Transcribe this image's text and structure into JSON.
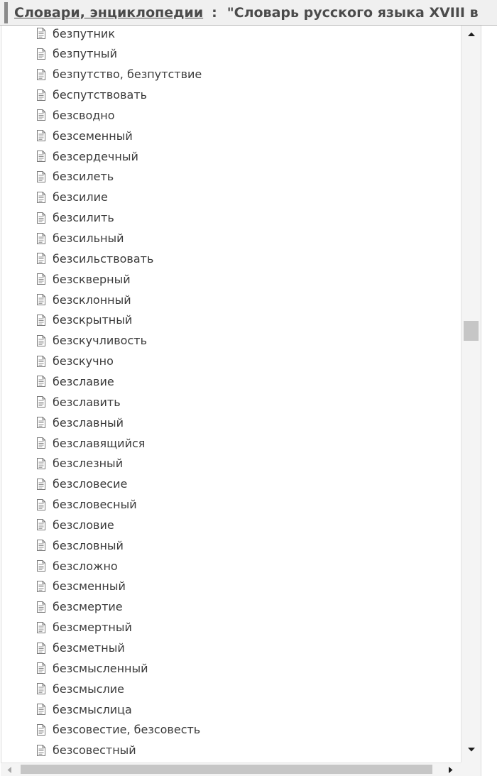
{
  "breadcrumb": {
    "category": "Словари, энциклопедии",
    "separator": ":",
    "document": "\"Словарь русского языка XVIII в"
  },
  "tree": {
    "items": [
      "безпутник",
      "безпутный",
      "безпутство, безпутствие",
      "беспутствовать",
      "безсводно",
      "безсеменный",
      "безсердечный",
      "безсилеть",
      "безсилие",
      "безсилить",
      "безсильный",
      "безсильствовать",
      "безскверный",
      "безсклонный",
      "безскрытный",
      "безскучливость",
      "безскучно",
      "безславие",
      "безславить",
      "безславный",
      "безславящийся",
      "безслезный",
      "безсловесие",
      "безсловесный",
      "безсловие",
      "безсловный",
      "безсложно",
      "безсменный",
      "безсмертие",
      "безсмертный",
      "безсметный",
      "безсмысленный",
      "безсмыслие",
      "безсмыслица",
      "безсовестие, безсовесть",
      "безсовестный"
    ]
  },
  "scrollbars": {
    "vertical_position": 0.41,
    "horizontal_position": 0.0
  },
  "icons": {
    "item": "document-icon",
    "scroll_up": "arrow-up-icon",
    "scroll_down": "arrow-down-icon",
    "scroll_left": "arrow-left-icon",
    "scroll_right": "arrow-right-icon"
  },
  "colors": {
    "text": "#3a3a3a",
    "breadcrumb_text": "#4b4b4b",
    "toolbar_bg": "#f0f0f0",
    "scroll_thumb": "#c6c6c6"
  }
}
